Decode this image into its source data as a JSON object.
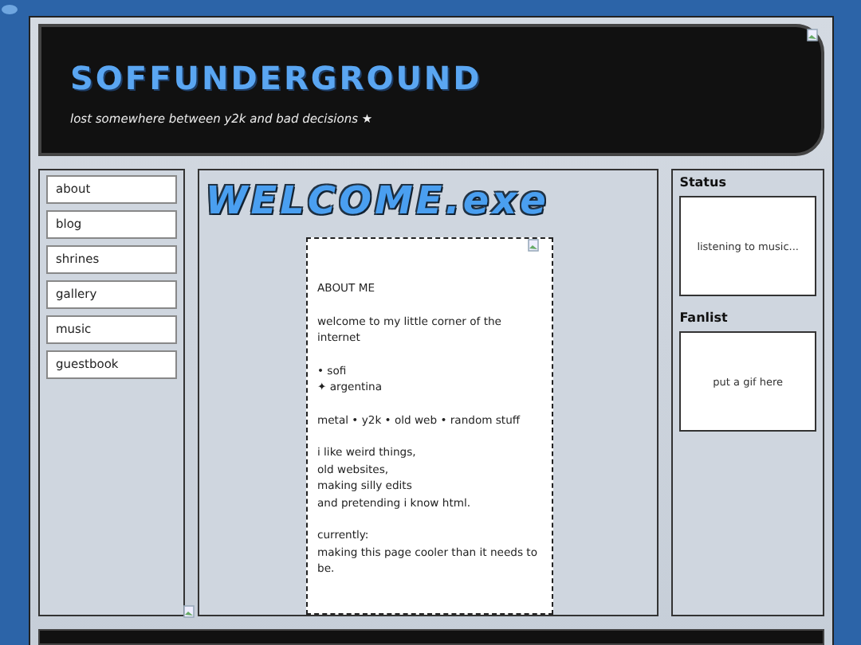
{
  "header": {
    "title": "SOFFUNDERGROUND",
    "tagline": "lost somewhere between y2k and bad decisions ★"
  },
  "nav": [
    {
      "label": "about"
    },
    {
      "label": "blog"
    },
    {
      "label": "shrines"
    },
    {
      "label": "gallery"
    },
    {
      "label": "music"
    },
    {
      "label": "guestbook"
    }
  ],
  "main": {
    "heading": "WELCOME.exe",
    "about_box": {
      "paragraphs": [
        [
          "ABOUT ME"
        ],
        [
          "welcome to my little corner of the internet"
        ],
        [
          "• sofi",
          "✦ argentina"
        ],
        [
          "metal • y2k • old web • random stuff"
        ],
        [
          "i like weird things,",
          "old websites,",
          "making silly edits",
          "and pretending i know html."
        ],
        [
          "currently:",
          "making this page cooler than it needs to be."
        ]
      ]
    }
  },
  "sidebar": [
    {
      "heading": "Status",
      "text": "listening to music..."
    },
    {
      "heading": "Fanlist",
      "text": "put a gif here"
    }
  ]
}
